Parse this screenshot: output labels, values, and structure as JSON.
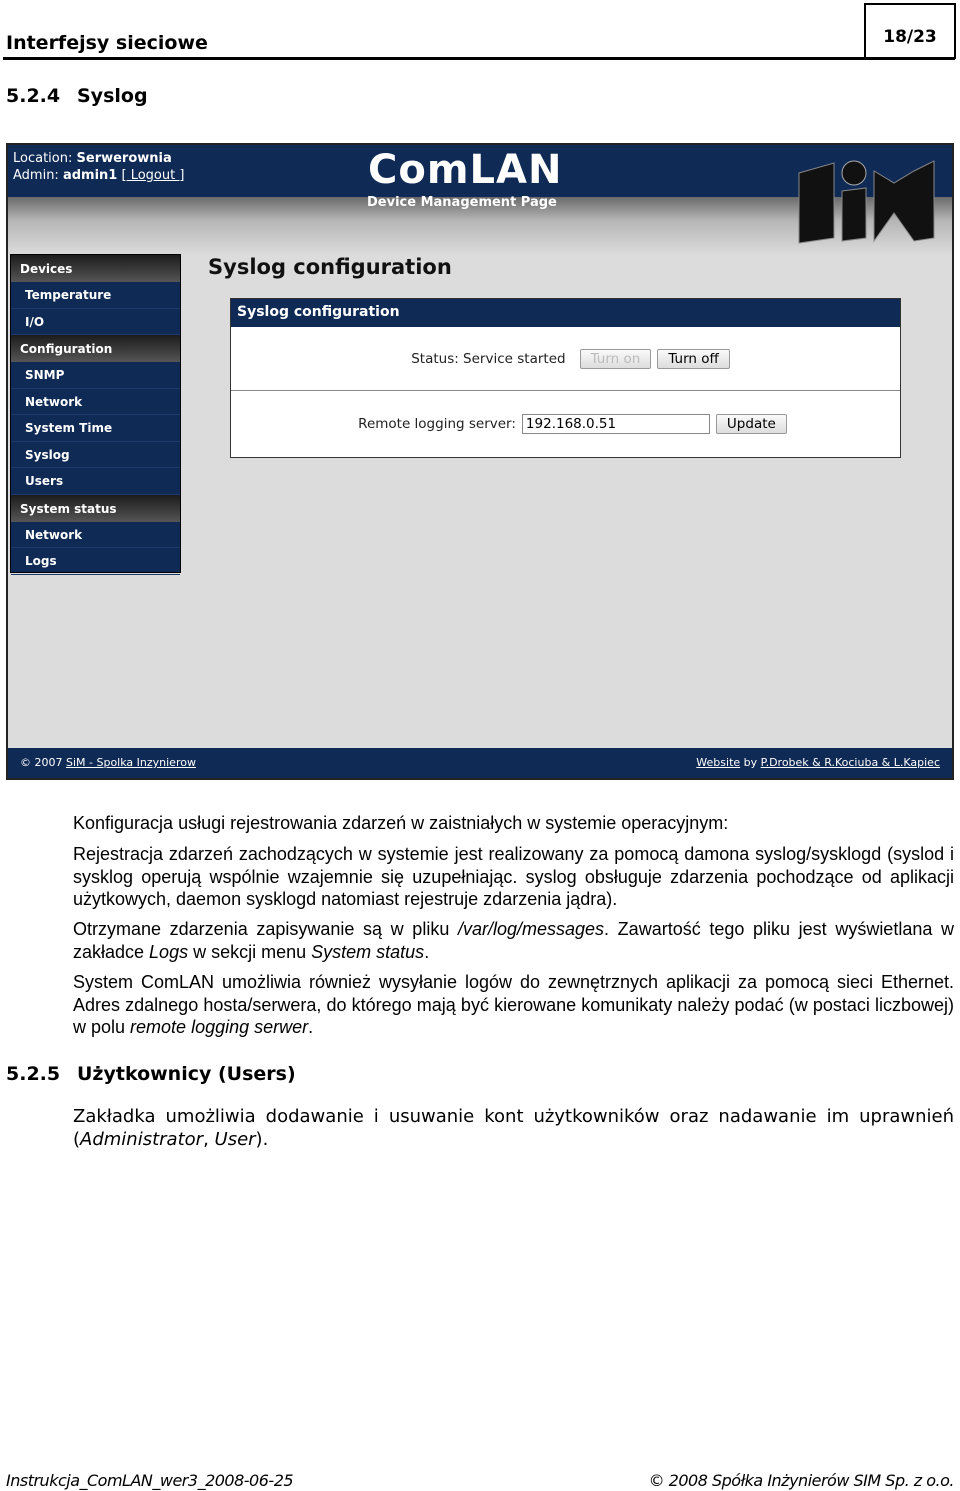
{
  "header": {
    "title": "Interfejsy sieciowe",
    "page": "18/23"
  },
  "section1": {
    "num": "5.2.4",
    "title": "Syslog"
  },
  "app": {
    "location_label": "Location:",
    "location": "Serwerownia",
    "admin_label": "Admin:",
    "admin": "admin1",
    "logout": "[ Logout ]",
    "brand": "ComLAN",
    "subtitle": "Device Management Page",
    "logo": "SiM",
    "sidebar": [
      {
        "type": "group",
        "label": "Devices"
      },
      {
        "type": "item",
        "label": "Temperature"
      },
      {
        "type": "item",
        "label": "I/O"
      },
      {
        "type": "group",
        "label": "Configuration"
      },
      {
        "type": "item",
        "label": "SNMP"
      },
      {
        "type": "item",
        "label": "Network"
      },
      {
        "type": "item",
        "label": "System Time"
      },
      {
        "type": "item",
        "label": "Syslog"
      },
      {
        "type": "item",
        "label": "Users"
      },
      {
        "type": "group",
        "label": "System status"
      },
      {
        "type": "item",
        "label": "Network"
      },
      {
        "type": "item",
        "label": "Logs"
      }
    ],
    "page_title": "Syslog configuration",
    "panel_title": "Syslog configuration",
    "status": "Status: Service started",
    "turn_on": "Turn on",
    "turn_off": "Turn off",
    "remote_label": "Remote logging server:",
    "remote_value": "192.168.0.51",
    "update": "Update",
    "footer_copy": "© 2007",
    "footer_link": "SiM - Spolka Inzynierow",
    "footer_website": "Website",
    "footer_by": "by",
    "footer_authors": "P.Drobek & R.Kociuba & L.Kapiec"
  },
  "body": {
    "p1": "Konfiguracja usługi rejestrowania zdarzeń w zaistniałych w systemie operacyjnym:",
    "p2": "Rejestracja zdarzeń zachodzących w systemie jest realizowany za pomocą damona syslog/sysklogd (syslod i sysklog operują wspólnie wzajemnie się uzupełniając. syslog obsługuje zdarzenia pochodzące od aplikacji użytkowych, daemon sysklogd natomiast rejestruje zdarzenia jądra).",
    "p3a": "Otrzymane zdarzenia zapisywanie są w pliku ",
    "p3b": "/var/log/messages",
    "p3c": ". Zawartość tego pliku jest wyświetlana w zakładce ",
    "p3d": "Logs",
    "p3e": " w sekcji menu ",
    "p3f": "System status",
    "p3g": ".",
    "p4a": "System ComLAN umożliwia również wysyłanie logów do zewnętrznych aplikacji za pomocą sieci Ethernet. Adres zdalnego hosta/serwera, do którego mają być kierowane komunikaty należy podać (w postaci liczbowej) w polu ",
    "p4b": "remote logging serwer",
    "p4c": "."
  },
  "section2": {
    "num": "5.2.5",
    "title": "Użytkownicy (Users)",
    "p_a": "Zakładka umożliwia dodawanie i usuwanie kont użytkowników oraz nadawanie im uprawnień (",
    "p_b": "Administrator",
    "p_c": ", ",
    "p_d": "User",
    "p_e": ")."
  },
  "footer": {
    "left": "Instrukcja_ComLAN_wer3_2008-06-25",
    "right": "© 2008 Spółka Inżynierów SIM Sp. z o.o."
  }
}
